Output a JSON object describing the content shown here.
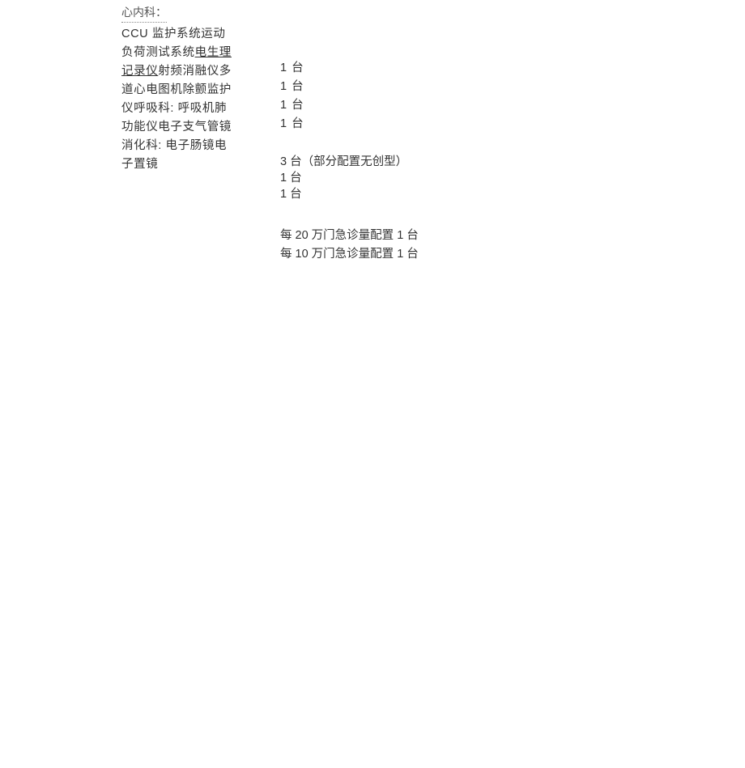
{
  "header": "心内科：",
  "left_flow_prefix": "CCU 监护系统运动负荷测试系统",
  "left_flow_ul": "电生理记录仪",
  "left_flow_suffix": "射频消融仪多道心电图机除颤监护仪呼吸科: 呼吸机肺功能仪电子支气管镜消化科: 电子肠镜电子置镜",
  "right_col_1": [
    "1 台",
    "1 台",
    "1 台",
    "1 台"
  ],
  "right_col_2": [
    "3 台（部分配置无创型）",
    "1 台",
    "1 台"
  ],
  "right_col_3": [
    "每 20 万门急诊量配置 1 台",
    "每 10 万门急诊量配置 1 台"
  ]
}
